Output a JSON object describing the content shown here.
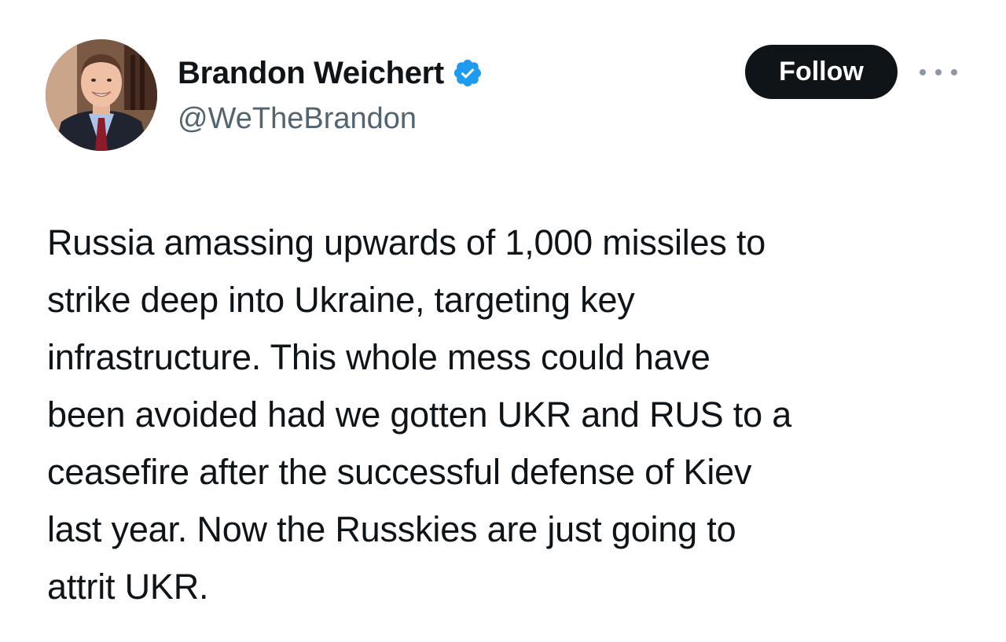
{
  "author": {
    "display_name": "Brandon Weichert",
    "handle": "@WeTheBrandon",
    "verified": true
  },
  "actions": {
    "follow_label": "Follow",
    "more_icon": "more-options-icon"
  },
  "tweet": {
    "text": "Russia amassing upwards of 1,000 missiles to\nstrike deep into Ukraine, targeting key\ninfrastructure. This whole mess could have\nbeen avoided had we gotten UKR and RUS to a\nceasefire after the successful defense of Kiev\nlast year. Now the Russkies are just going to\nattrit UKR."
  },
  "colors": {
    "verified_badge": "#1d9bf0",
    "follow_button_bg": "#0f1419",
    "follow_button_text": "#ffffff",
    "handle_text": "#536471",
    "body_text": "#0f1419"
  }
}
